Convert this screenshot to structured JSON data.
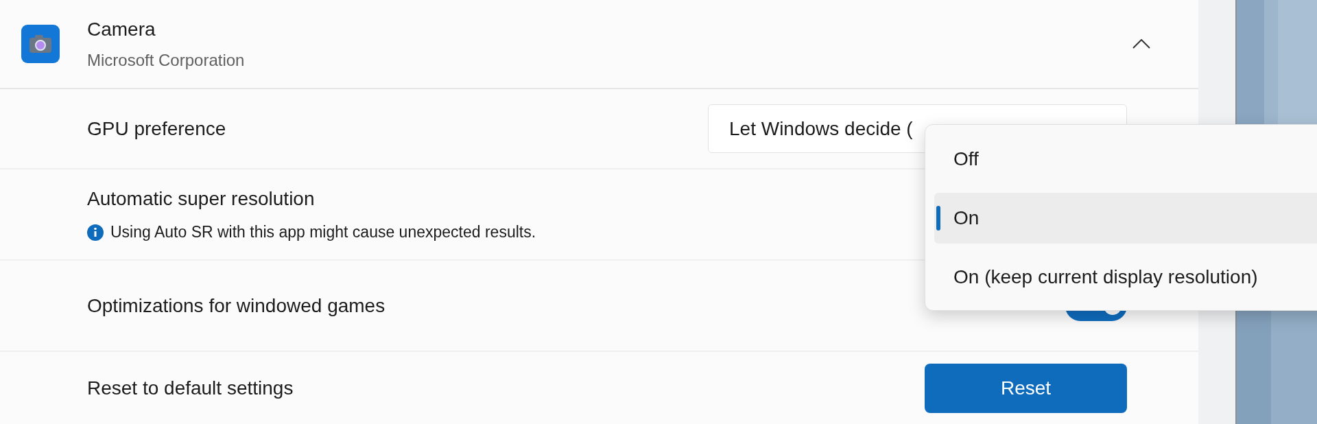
{
  "app": {
    "name": "Camera",
    "publisher": "Microsoft Corporation",
    "expanded": true
  },
  "settings": [
    {
      "kind": "dropdown",
      "label": "GPU preference",
      "value": "Let Windows decide ("
    },
    {
      "kind": "info",
      "label": "Automatic super resolution",
      "note": "Using Auto SR with this app might cause unexpected results."
    },
    {
      "kind": "toggle",
      "label": "Optimizations for windowed games",
      "on": true
    },
    {
      "kind": "button",
      "label": "Reset to default settings",
      "button": "Reset"
    }
  ],
  "menu": {
    "items": [
      {
        "label": "Off",
        "selected": false
      },
      {
        "label": "On",
        "selected": true
      },
      {
        "label": "On (keep current display resolution)",
        "selected": false
      }
    ]
  }
}
